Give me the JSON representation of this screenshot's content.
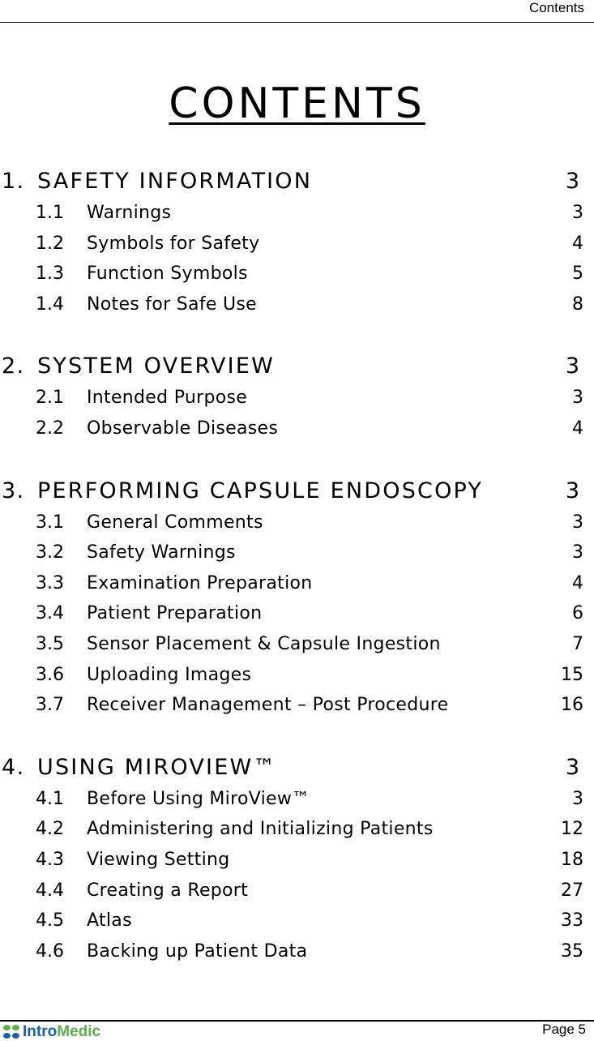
{
  "header": {
    "running_title": "Contents"
  },
  "title": "CONTENTS",
  "sections": [
    {
      "number": "1.",
      "title": "SAFETY INFORMATION",
      "page": "3",
      "items": [
        {
          "number": "1.1",
          "title": "Warnings",
          "page": "3"
        },
        {
          "number": "1.2",
          "title": "Symbols for Safety",
          "page": "4"
        },
        {
          "number": "1.3",
          "title": "Function Symbols",
          "page": "5"
        },
        {
          "number": "1.4",
          "title": "Notes for Safe Use",
          "page": "8"
        }
      ]
    },
    {
      "number": "2.",
      "title": "SYSTEM OVERVIEW",
      "page": "3",
      "items": [
        {
          "number": "2.1",
          "title": "Intended Purpose",
          "page": "3"
        },
        {
          "number": "2.2",
          "title": "Observable Diseases",
          "page": "4"
        }
      ]
    },
    {
      "number": "3.",
      "title": "PERFORMING CAPSULE ENDOSCOPY",
      "page": "3",
      "items": [
        {
          "number": "3.1",
          "title": "General Comments",
          "page": "3"
        },
        {
          "number": "3.2",
          "title": "Safety Warnings",
          "page": "3"
        },
        {
          "number": "3.3",
          "title": "Examination Preparation",
          "page": "4"
        },
        {
          "number": "3.4",
          "title": "Patient Preparation",
          "page": "6"
        },
        {
          "number": "3.5",
          "title": "Sensor Placement & Capsule Ingestion",
          "page": "7"
        },
        {
          "number": "3.6",
          "title": "Uploading Images",
          "page": "15"
        },
        {
          "number": "3.7",
          "title": "Receiver Management – Post Procedure",
          "page": "16"
        }
      ]
    },
    {
      "number": "4.",
      "title": "USING MIROVIEW™",
      "page": "3",
      "items": [
        {
          "number": "4.1",
          "title": "Before Using MiroView™",
          "page": "3"
        },
        {
          "number": "4.2",
          "title": "Administering and Initializing Patients",
          "page": "12"
        },
        {
          "number": "4.3",
          "title": "Viewing Setting",
          "page": "18"
        },
        {
          "number": "4.4",
          "title": "Creating a Report",
          "page": "27"
        },
        {
          "number": "4.5",
          "title": "Atlas",
          "page": "33"
        },
        {
          "number": "4.6",
          "title": "Backing up Patient Data",
          "page": "35"
        }
      ]
    }
  ],
  "footer": {
    "logo": {
      "part1": "Intro",
      "part2": "Medic",
      "color1": "#1e5fa8",
      "color2": "#5bb04a"
    },
    "page_label": "Page 5"
  }
}
